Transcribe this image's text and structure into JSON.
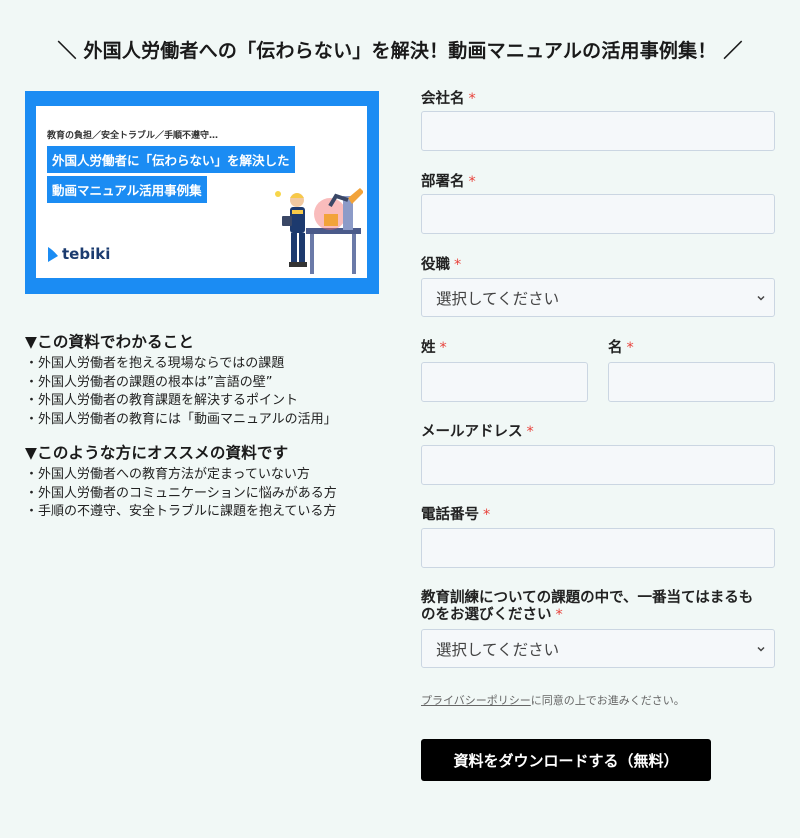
{
  "heading": "＼ 外国人労働者への「伝わらない」を解決！動画マニュアルの活用事例集！ ／",
  "banner": {
    "kicker": "教育の負担／安全トラブル／手順不遵守…",
    "title_line1": "外国人労働者に「伝わらない」を解決した",
    "title_line2": "動画マニュアル活用事例集",
    "brand": "tebiki"
  },
  "info": {
    "block1": {
      "title": "▼この資料でわかること",
      "items": [
        "・外国人労働者を抱える現場ならではの課題",
        "・外国人労働者の課題の根本は”言語の壁”",
        "・外国人労働者の教育課題を解決するポイント",
        "・外国人労働者の教育には「動画マニュアルの活用」"
      ]
    },
    "block2": {
      "title": "▼このような方にオススメの資料です",
      "items": [
        "・外国人労働者への教育方法が定まっていない方",
        "・外国人労働者のコミュニケーションに悩みがある方",
        "・手順の不遵守、安全トラブルに課題を抱えている方"
      ]
    }
  },
  "form": {
    "required_mark": "*",
    "company_label": "会社名",
    "department_label": "部署名",
    "position_label": "役職",
    "position_value": "選択してください",
    "lastname_label": "姓",
    "firstname_label": "名",
    "email_label": "メールアドレス",
    "phone_label": "電話番号",
    "challenge_label_line1": "教育訓練についての課題の中で、一番当てはまるも",
    "challenge_label_line2": "のをお選びください",
    "challenge_value": "選択してください",
    "privacy_link": "プライバシーポリシー",
    "privacy_text": "に同意の上でお進みください。",
    "submit_label": "資料をダウンロードする（無料）"
  },
  "colors": {
    "background": "#f1f8f6",
    "banner_blue": "#1b8cf3",
    "required": "#e8413a",
    "submit_bg": "#000000"
  }
}
